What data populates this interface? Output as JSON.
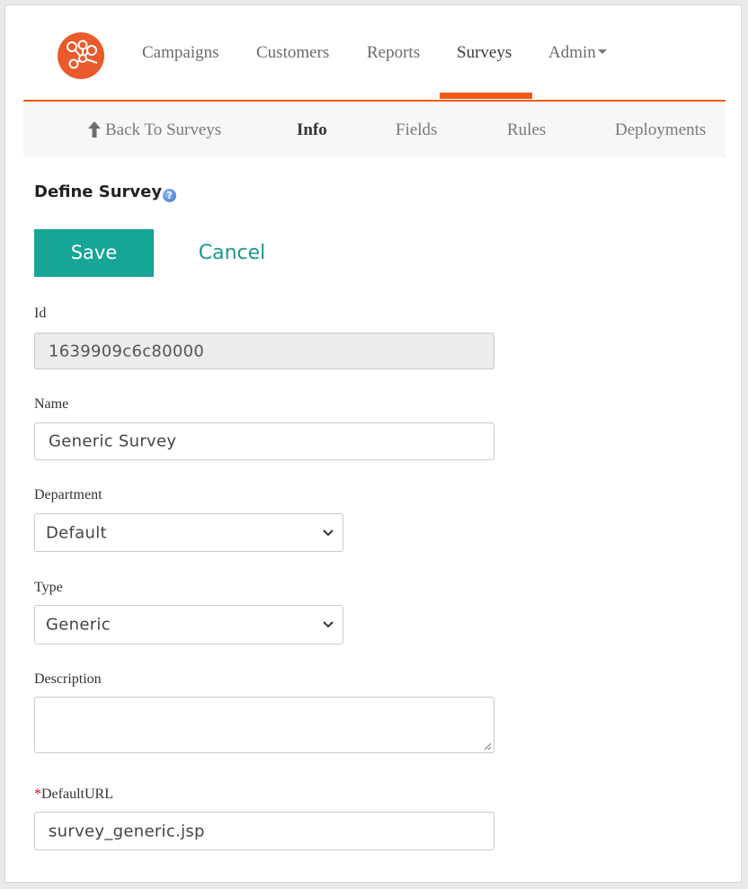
{
  "nav": {
    "items": [
      "Campaigns",
      "Customers",
      "Reports",
      "Surveys",
      "Admin"
    ],
    "active": "Surveys",
    "accent": "#ef5a17",
    "logo_color": "#ea5a2b"
  },
  "subnav": {
    "back_label": "Back To Surveys",
    "tabs": [
      "Info",
      "Fields",
      "Rules",
      "Deployments"
    ],
    "active": "Info"
  },
  "page": {
    "title": "Define Survey",
    "help_icon": "?",
    "save_label": "Save",
    "cancel_label": "Cancel",
    "save_color": "#16a596"
  },
  "form": {
    "id": {
      "label": "Id",
      "value": "1639909c6c80000"
    },
    "name": {
      "label": "Name",
      "value": "Generic Survey"
    },
    "department": {
      "label": "Department",
      "value": "Default"
    },
    "type": {
      "label": "Type",
      "value": "Generic"
    },
    "description": {
      "label": "Description",
      "value": ""
    },
    "default_url": {
      "required_mark": "*",
      "label": "DefaultURL",
      "value": "survey_generic.jsp"
    }
  }
}
